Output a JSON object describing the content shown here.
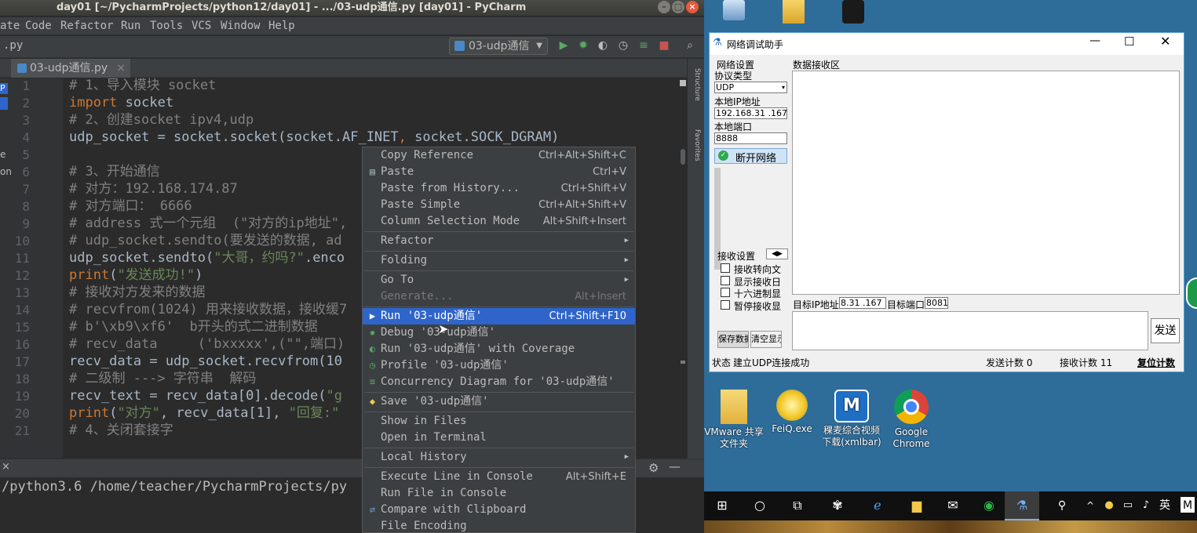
{
  "pycharm": {
    "title": "day01 [~/PycharmProjects/python12/day01] - .../03-udp通信.py [day01] - PyCharm",
    "menu": [
      "ate",
      "Code",
      "Refactor",
      "Run",
      "Tools",
      "VCS",
      "Window",
      "Help"
    ],
    "breadcrumb": ".py",
    "run_config": "03-udp通信",
    "tab": "03-udp通信.py",
    "left_fragments": [
      "P",
      "e",
      "on"
    ],
    "side_labels": [
      "Structure",
      "Favorites"
    ],
    "line_numbers": [
      "1",
      "2",
      "3",
      "4",
      "5",
      "6",
      "7",
      "8",
      "9",
      "10",
      "11",
      "12",
      "13",
      "14",
      "15",
      "16",
      "17",
      "18",
      "19",
      "20",
      "21"
    ],
    "code_lines": [
      [
        {
          "c": "cm",
          "t": "# 1、导入模块 socket"
        }
      ],
      [
        {
          "c": "kw",
          "t": "import"
        },
        {
          "c": "",
          "t": " socket"
        }
      ],
      [
        {
          "c": "cm",
          "t": "# 2、创建socket ipv4,udp"
        }
      ],
      [
        {
          "c": "",
          "t": "udp_socket = socket.socket(socket.AF_INET"
        },
        {
          "c": "kw",
          "t": ","
        },
        {
          "c": "",
          "t": " socket.SOCK_DGRAM)"
        }
      ],
      [
        {
          "c": "",
          "t": ""
        }
      ],
      [
        {
          "c": "cm",
          "t": "# 3、开始通信"
        }
      ],
      [
        {
          "c": "cm",
          "t": "# 对方：192.168.174.87"
        }
      ],
      [
        {
          "c": "cm",
          "t": "# 对方端口： 6666"
        }
      ],
      [
        {
          "c": "cm",
          "t": "# address 式一个元组  (\"对方的ip地址\","
        }
      ],
      [
        {
          "c": "cm",
          "t": "# udp_socket.sendto(要发送的数据, ad"
        }
      ],
      [
        {
          "c": "",
          "t": "udp_socket.sendto("
        },
        {
          "c": "st",
          "t": "\"大哥，约吗?\""
        },
        {
          "c": "",
          "t": ".enco"
        }
      ],
      [
        {
          "c": "kw",
          "t": "print"
        },
        {
          "c": "",
          "t": "("
        },
        {
          "c": "st",
          "t": "\"发送成功!\""
        },
        {
          "c": "",
          "t": ")"
        }
      ],
      [
        {
          "c": "cm",
          "t": "# 接收对方发来的数据"
        }
      ],
      [
        {
          "c": "cm",
          "t": "# recvfrom(1024) 用来接收数据，接收缓7"
        }
      ],
      [
        {
          "c": "cm",
          "t": "# b'\\xb9\\xf6'  b开头的式二进制数据"
        }
      ],
      [
        {
          "c": "cm",
          "t": "# recv_data     ('bxxxxx',(\"\",端口)"
        }
      ],
      [
        {
          "c": "",
          "t": "recv_data = udp_socket.recvfrom(10"
        }
      ],
      [
        {
          "c": "cm",
          "t": "# 二级制 ---> 字符串  解码"
        }
      ],
      [
        {
          "c": "",
          "t": "recv_text = recv_data[0].decode("
        },
        {
          "c": "st",
          "t": "\"g"
        }
      ],
      [
        {
          "c": "kw",
          "t": "print"
        },
        {
          "c": "",
          "t": "("
        },
        {
          "c": "st",
          "t": "\"对方\""
        },
        {
          "c": "",
          "t": ", recv_data[1], "
        },
        {
          "c": "st",
          "t": "\"回复:\""
        }
      ],
      [
        {
          "c": "cm",
          "t": "# 4、关闭套接字"
        }
      ]
    ],
    "terminal_line": "/python3.6 /home/teacher/PycharmProjects/py"
  },
  "context_menu": [
    {
      "type": "item",
      "label": "Copy Reference",
      "shortcut": "Ctrl+Alt+Shift+C",
      "icon": ""
    },
    {
      "type": "item",
      "label": "Paste",
      "shortcut": "Ctrl+V",
      "icon": "clipboard-icon"
    },
    {
      "type": "item",
      "label": "Paste from History...",
      "shortcut": "Ctrl+Shift+V",
      "icon": ""
    },
    {
      "type": "item",
      "label": "Paste Simple",
      "shortcut": "Ctrl+Alt+Shift+V",
      "icon": ""
    },
    {
      "type": "item",
      "label": "Column Selection Mode",
      "shortcut": "Alt+Shift+Insert",
      "icon": ""
    },
    {
      "type": "sep"
    },
    {
      "type": "sub",
      "label": "Refactor"
    },
    {
      "type": "sep"
    },
    {
      "type": "sub",
      "label": "Folding"
    },
    {
      "type": "sep"
    },
    {
      "type": "sub",
      "label": "Go To"
    },
    {
      "type": "item",
      "label": "Generate...",
      "shortcut": "Alt+Insert",
      "icon": "",
      "disabled": true
    },
    {
      "type": "sep"
    },
    {
      "type": "item",
      "label": "Run '03-udp通信'",
      "shortcut": "Ctrl+Shift+F10",
      "icon": "run-icon",
      "selected": true
    },
    {
      "type": "item",
      "label": "Debug '03-udp通信'",
      "shortcut": "",
      "icon": "debug-icon"
    },
    {
      "type": "item",
      "label": "Run '03-udp通信' with Coverage",
      "shortcut": "",
      "icon": "coverage-icon"
    },
    {
      "type": "item",
      "label": "Profile '03-udp通信'",
      "shortcut": "",
      "icon": "profile-icon"
    },
    {
      "type": "item",
      "label": "Concurrency Diagram for '03-udp通信'",
      "shortcut": "",
      "icon": "concurrency-icon"
    },
    {
      "type": "sep"
    },
    {
      "type": "item",
      "label": "Save '03-udp通信'",
      "shortcut": "",
      "icon": "python-icon"
    },
    {
      "type": "sep"
    },
    {
      "type": "item",
      "label": "Show in Files",
      "shortcut": "",
      "icon": ""
    },
    {
      "type": "item",
      "label": "Open in Terminal",
      "shortcut": "",
      "icon": ""
    },
    {
      "type": "sep"
    },
    {
      "type": "sub",
      "label": "Local History"
    },
    {
      "type": "sep"
    },
    {
      "type": "item",
      "label": "Execute Line in Console",
      "shortcut": "Alt+Shift+E",
      "icon": ""
    },
    {
      "type": "item",
      "label": "Run File in Console",
      "shortcut": "",
      "icon": ""
    },
    {
      "type": "item",
      "label": "Compare with Clipboard",
      "shortcut": "",
      "icon": "compare-icon"
    },
    {
      "type": "item",
      "label": "File Encoding",
      "shortcut": "",
      "icon": ""
    }
  ],
  "netassist": {
    "title": "网络调试助手",
    "net_settings": "网络设置",
    "protocol_label": "协议类型",
    "protocol_value": "UDP",
    "local_ip_label": "本地IP地址",
    "local_ip_value": "192.168.31 .167",
    "local_port_label": "本地端口",
    "local_port_value": "8888",
    "disconnect_button": "断开网络",
    "receive_area_label": "数据接收区",
    "receive_settings": "接收设置",
    "checkboxes": [
      "接收转向文",
      "显示接收日",
      "十六进制显",
      "暂停接收显"
    ],
    "save_button": "保存数据",
    "clear_button": "清空显示",
    "target_ip_label": "目标IP地址",
    "target_ip_value": "8.31 .167",
    "target_port_label": "目标端口",
    "target_port_value": "8081",
    "send_button": "发送",
    "status_label": "状态",
    "status_text": "建立UDP连接成功",
    "send_count": "发送计数 0",
    "recv_count": "接收计数 11",
    "reset_count": "复位计数"
  },
  "desktop_icons": [
    {
      "name": "vmware-shared-folder",
      "label": "VMware 共享文件夹"
    },
    {
      "name": "feiq",
      "label": "FeiQ.exe"
    },
    {
      "name": "xmlbar",
      "label": "稞麦综合视频下载(xmlbar)"
    },
    {
      "name": "chrome",
      "label": "Google Chrome"
    }
  ],
  "tray": {
    "ime": "英"
  },
  "colors": {
    "selection": "#2f65ca",
    "ide_bg": "#2b2b2b",
    "desktop_bg": "#2e6c9a"
  }
}
